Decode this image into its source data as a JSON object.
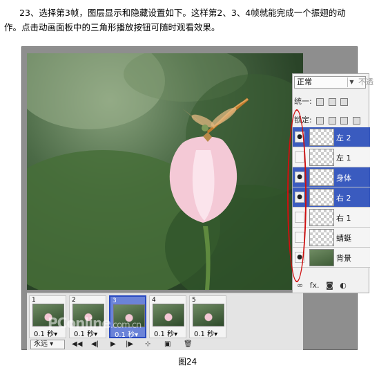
{
  "intro": {
    "line1": "23、选择第3帧，图层显示和隐藏设置如下。这样第2、3、4帧就能完成一个振翅的动",
    "line2": "作。点击动画面板中的三角形播放按钮可随时观看效果。"
  },
  "layers_panel": {
    "blend_mode": "正常",
    "opacity_label": "不透",
    "unify_label": "统一:",
    "lock_label": "锁定:",
    "layers": [
      {
        "name": "左 2",
        "visible": true,
        "selected": true
      },
      {
        "name": "左 1",
        "visible": false,
        "selected": false
      },
      {
        "name": "身体",
        "visible": true,
        "selected": true
      },
      {
        "name": "右 2",
        "visible": true,
        "selected": true
      },
      {
        "name": "右 1",
        "visible": false,
        "selected": false
      },
      {
        "name": "蜻蜓",
        "visible": false,
        "selected": false
      },
      {
        "name": "背景",
        "visible": true,
        "selected": false
      }
    ],
    "bottom_icons": [
      "link-icon",
      "fx-icon",
      "mask-icon",
      "adjustment-icon"
    ],
    "bottom_fx": "fx.",
    "eye_glyph": "●"
  },
  "animation_panel": {
    "frames": [
      {
        "num": "1",
        "delay": "0.1 秒▾",
        "selected": false
      },
      {
        "num": "2",
        "delay": "0.1 秒▾",
        "selected": false
      },
      {
        "num": "3",
        "delay": "0.1 秒▾",
        "selected": true
      },
      {
        "num": "4",
        "delay": "0.1 秒▾",
        "selected": false
      },
      {
        "num": "5",
        "delay": "0.1 秒▾",
        "selected": false
      }
    ],
    "loop": "永远",
    "controls": [
      "◀◀",
      "◀|",
      "▶",
      "|▶",
      "⊹",
      "▣",
      "🗑"
    ]
  },
  "watermark": {
    "brand": "PConline",
    "domain": ".com.cn"
  },
  "caption": "图24",
  "accent_color": "#3a5bbf",
  "annotation_color": "#d01010"
}
